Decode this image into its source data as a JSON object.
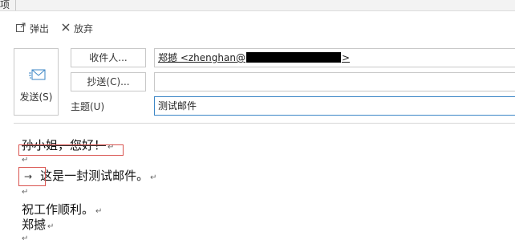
{
  "top_tab": {
    "label": "项"
  },
  "toolbar": {
    "popout_label": "弹出",
    "discard_label": "放弃"
  },
  "send": {
    "label": "发送(S)"
  },
  "to": {
    "button_label": "收件人...",
    "value_prefix": "郑撼 <zhenghan@",
    "value_suffix": ">"
  },
  "cc": {
    "button_label": "抄送(C)...",
    "value": ""
  },
  "subject": {
    "label": "主题(U)",
    "value": "测试邮件"
  },
  "body": {
    "greeting": "孙小姐，您好！",
    "paragraph1_tab": "→",
    "paragraph1": "这是一封测试邮件。",
    "closing": "祝工作顺利。",
    "signature": "郑撼",
    "paragraph_mark": "↵"
  },
  "colors": {
    "accent": "#3b86c6",
    "highlight_box": "#d9534f"
  },
  "icons": [
    "popout-icon",
    "close-icon",
    "envelope-icon"
  ]
}
